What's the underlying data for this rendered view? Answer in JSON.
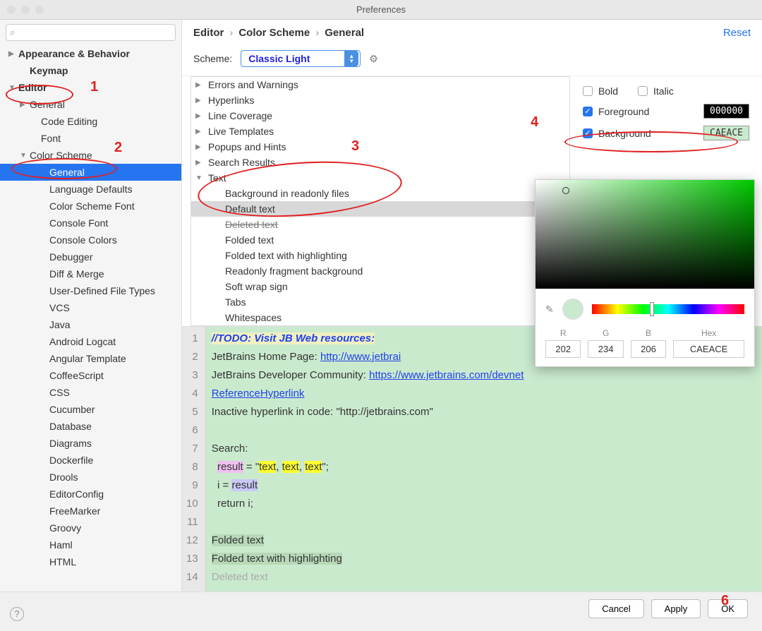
{
  "window_title": "Preferences",
  "search_placeholder": "",
  "sidebar": {
    "items": [
      {
        "label": "Appearance & Behavior",
        "bold": true,
        "exp": "▶",
        "lvl": ""
      },
      {
        "label": "Keymap",
        "bold": true,
        "lvl": "lvl1"
      },
      {
        "label": "Editor",
        "bold": true,
        "exp": "▼",
        "lvl": ""
      },
      {
        "label": "General",
        "exp": "▶",
        "lvl": "lvl1"
      },
      {
        "label": "Code Editing",
        "lvl": "lvl2"
      },
      {
        "label": "Font",
        "lvl": "lvl2"
      },
      {
        "label": "Color Scheme",
        "exp": "▼",
        "lvl": "lvl1"
      },
      {
        "label": "General",
        "lvl": "lvl3",
        "selected": true
      },
      {
        "label": "Language Defaults",
        "lvl": "lvl3"
      },
      {
        "label": "Color Scheme Font",
        "lvl": "lvl3"
      },
      {
        "label": "Console Font",
        "lvl": "lvl3"
      },
      {
        "label": "Console Colors",
        "lvl": "lvl3"
      },
      {
        "label": "Debugger",
        "lvl": "lvl3"
      },
      {
        "label": "Diff & Merge",
        "lvl": "lvl3"
      },
      {
        "label": "User-Defined File Types",
        "lvl": "lvl3"
      },
      {
        "label": "VCS",
        "lvl": "lvl3"
      },
      {
        "label": "Java",
        "lvl": "lvl3"
      },
      {
        "label": "Android Logcat",
        "lvl": "lvl3"
      },
      {
        "label": "Angular Template",
        "lvl": "lvl3"
      },
      {
        "label": "CoffeeScript",
        "lvl": "lvl3"
      },
      {
        "label": "CSS",
        "lvl": "lvl3"
      },
      {
        "label": "Cucumber",
        "lvl": "lvl3"
      },
      {
        "label": "Database",
        "lvl": "lvl3"
      },
      {
        "label": "Diagrams",
        "lvl": "lvl3"
      },
      {
        "label": "Dockerfile",
        "lvl": "lvl3"
      },
      {
        "label": "Drools",
        "lvl": "lvl3"
      },
      {
        "label": "EditorConfig",
        "lvl": "lvl3"
      },
      {
        "label": "FreeMarker",
        "lvl": "lvl3"
      },
      {
        "label": "Groovy",
        "lvl": "lvl3"
      },
      {
        "label": "Haml",
        "lvl": "lvl3"
      },
      {
        "label": "HTML",
        "lvl": "lvl3"
      }
    ]
  },
  "breadcrumb": [
    "Editor",
    "Color Scheme",
    "General"
  ],
  "reset": "Reset",
  "scheme": {
    "label": "Scheme:",
    "value": "Classic Light"
  },
  "categories": [
    {
      "label": "Errors and Warnings",
      "exp": "▶"
    },
    {
      "label": "Hyperlinks",
      "exp": "▶"
    },
    {
      "label": "Line Coverage",
      "exp": "▶"
    },
    {
      "label": "Live Templates",
      "exp": "▶"
    },
    {
      "label": "Popups and Hints",
      "exp": "▶"
    },
    {
      "label": "Search Results",
      "exp": "▶"
    },
    {
      "label": "Text",
      "exp": "▼"
    },
    {
      "label": "Background in readonly files",
      "sub": true
    },
    {
      "label": "Default text",
      "sub": true,
      "sel": true
    },
    {
      "label": "Deleted text",
      "sub": true,
      "struck": true
    },
    {
      "label": "Folded text",
      "sub": true
    },
    {
      "label": "Folded text with highlighting",
      "sub": true
    },
    {
      "label": "Readonly fragment background",
      "sub": true
    },
    {
      "label": "Soft wrap sign",
      "sub": true
    },
    {
      "label": "Tabs",
      "sub": true
    },
    {
      "label": "Whitespaces",
      "sub": true
    }
  ],
  "props": {
    "bold": "Bold",
    "italic": "Italic",
    "foreground": "Foreground",
    "background": "Background",
    "fg_value": "000000",
    "bg_value": "CAEACE"
  },
  "picker": {
    "r_label": "R",
    "g_label": "G",
    "b_label": "B",
    "hex_label": "Hex",
    "r": "202",
    "g": "234",
    "b": "206",
    "hex": "CAEACE"
  },
  "preview": {
    "lines": [
      "1",
      "2",
      "3",
      "4",
      "5",
      "6",
      "7",
      "8",
      "9",
      "10",
      "11",
      "12",
      "13",
      "14"
    ]
  },
  "footer": {
    "cancel": "Cancel",
    "apply": "Apply",
    "ok": "OK"
  },
  "annotations": {
    "a1": "1",
    "a2": "2",
    "a3": "3",
    "a4": "4",
    "a6": "6"
  }
}
